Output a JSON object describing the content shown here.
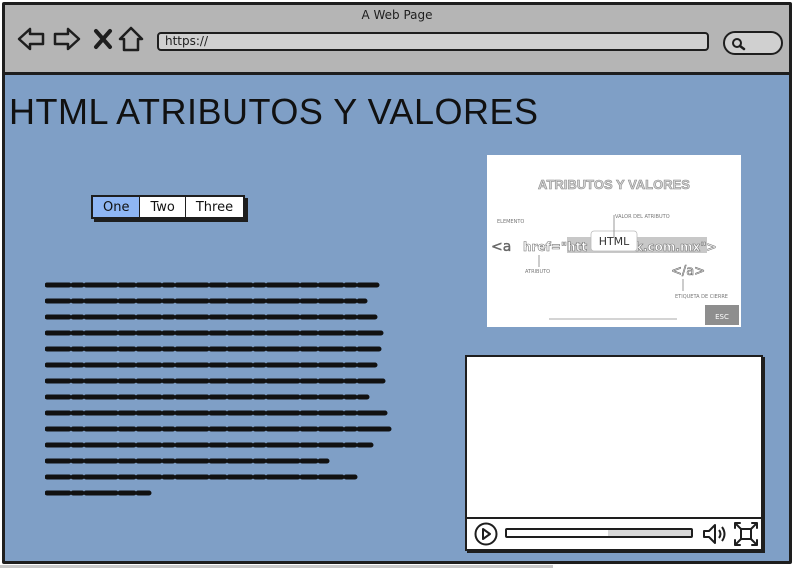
{
  "window": {
    "title": "A Web Page"
  },
  "toolbar": {
    "back_icon": "back-arrow-icon",
    "forward_icon": "forward-arrow-icon",
    "close_icon": "close-x-icon",
    "home_icon": "home-icon",
    "url": "https://",
    "search_icon": "search-icon"
  },
  "page": {
    "title": "HTML ATRIBUTOS Y VALORES",
    "tabs": [
      {
        "label": "One",
        "active": true
      },
      {
        "label": "Two",
        "active": false
      },
      {
        "label": "Three",
        "active": false
      }
    ]
  },
  "image": {
    "heading": "ATRIBUTOS Y VALORES",
    "element_label": "ELEMENTO",
    "value_label": "VALOR DEL ATRIBUTO",
    "attribute_label": "ATRIBUTO",
    "closing_label": "ETIQUETA DE CIERRE",
    "code_start": "<a",
    "code_attr": "href=\"htt",
    "code_end": "k.com.mx\">",
    "closing_tag": "</a>",
    "tooltip": "HTML",
    "corner_badge": "ESC"
  },
  "video": {
    "progress": 0.55,
    "play_icon": "play-icon",
    "volume_icon": "volume-icon",
    "fullscreen_icon": "fullscreen-icon"
  },
  "colors": {
    "page_bg": "#7f9fc6",
    "titlebar_bg": "#b5b5b5",
    "active_tab": "#8fb6f4"
  }
}
